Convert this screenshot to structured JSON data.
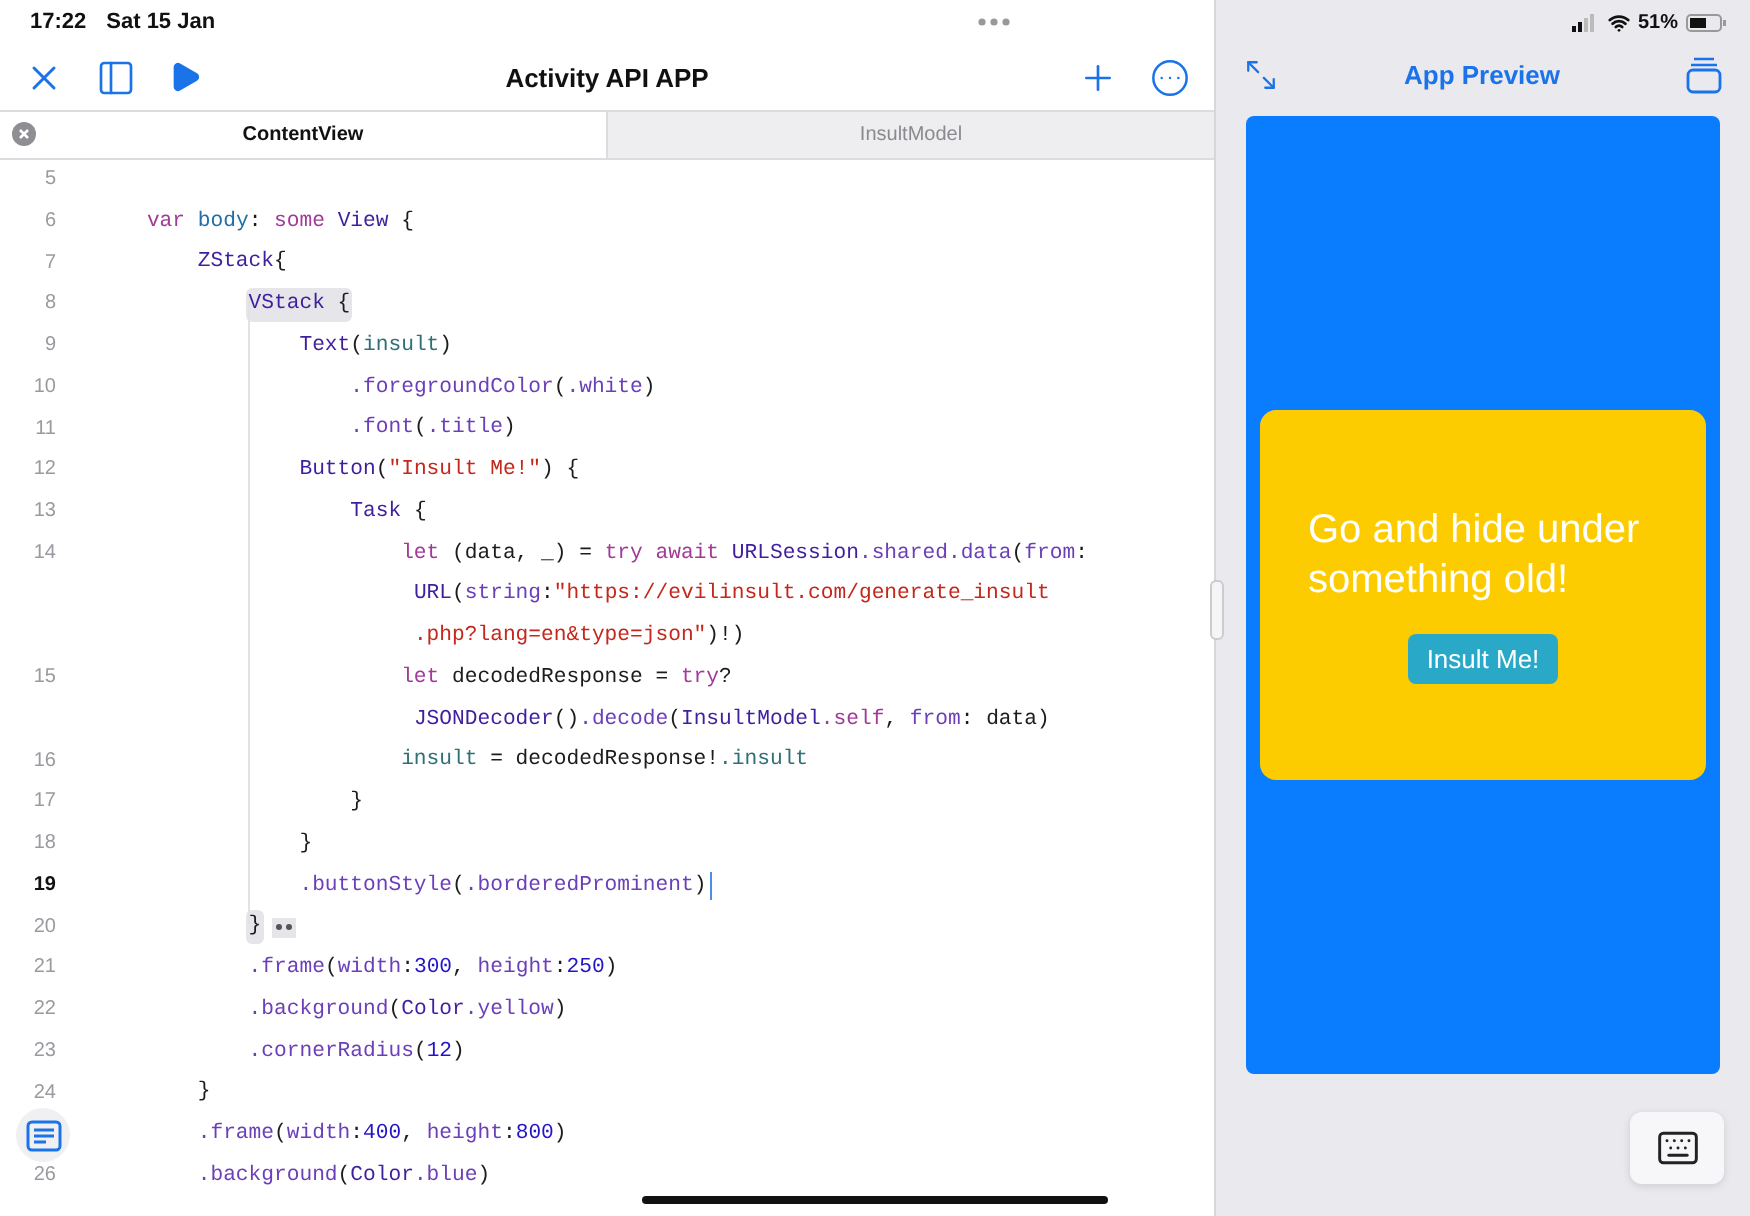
{
  "status_bar": {
    "time": "17:22",
    "date": "Sat 15 Jan",
    "battery": "51%"
  },
  "toolbar": {
    "title": "Activity API APP"
  },
  "tabs": [
    {
      "label": "ContentView",
      "selected": true,
      "closable": true
    },
    {
      "label": "InsultModel",
      "selected": false,
      "closable": false
    }
  ],
  "editor": {
    "lines": [
      {
        "number": "5"
      },
      {
        "number": "6",
        "rows": [
          {
            "tokens": [
              {
                "text": "    var ",
                "kind": "keyword"
              },
              {
                "text": "body",
                "kind": "decl"
              },
              {
                "text": ": ",
                "kind": "plain"
              },
              {
                "text": "some ",
                "kind": "keyword"
              },
              {
                "text": "View",
                "kind": "type"
              },
              {
                "text": " {",
                "kind": "plain"
              }
            ]
          }
        ]
      },
      {
        "number": "7",
        "rows": [
          {
            "tokens": [
              {
                "text": "        ZStack",
                "kind": "type"
              },
              {
                "text": "{",
                "kind": "plain"
              }
            ]
          }
        ]
      },
      {
        "number": "8",
        "highlighted": true,
        "rows": [
          {
            "tokens": [
              {
                "text": "            VStack",
                "kind": "type"
              },
              {
                "text": " {",
                "kind": "plain"
              }
            ]
          }
        ]
      },
      {
        "number": "9",
        "rows": [
          {
            "tokens": [
              {
                "text": "                Text",
                "kind": "type"
              },
              {
                "text": "(",
                "kind": "plain"
              },
              {
                "text": "insult",
                "kind": "var"
              },
              {
                "text": ")",
                "kind": "plain"
              }
            ]
          }
        ]
      },
      {
        "number": "10",
        "rows": [
          {
            "tokens": [
              {
                "text": "                    .foregroundColor",
                "kind": "member"
              },
              {
                "text": "(",
                "kind": "plain"
              },
              {
                "text": ".white",
                "kind": "member"
              },
              {
                "text": ")",
                "kind": "plain"
              }
            ]
          }
        ]
      },
      {
        "number": "11",
        "rows": [
          {
            "tokens": [
              {
                "text": "                    .font",
                "kind": "member"
              },
              {
                "text": "(",
                "kind": "plain"
              },
              {
                "text": ".title",
                "kind": "member"
              },
              {
                "text": ")",
                "kind": "plain"
              }
            ]
          }
        ]
      },
      {
        "number": "12",
        "rows": [
          {
            "tokens": [
              {
                "text": "                Button",
                "kind": "type"
              },
              {
                "text": "(",
                "kind": "plain"
              },
              {
                "text": "\"Insult Me!\"",
                "kind": "string"
              },
              {
                "text": ") {",
                "kind": "plain"
              }
            ]
          }
        ]
      },
      {
        "number": "13",
        "rows": [
          {
            "tokens": [
              {
                "text": "                    Task",
                "kind": "type"
              },
              {
                "text": " {",
                "kind": "plain"
              }
            ]
          }
        ]
      },
      {
        "number": "14",
        "rows": [
          {
            "tokens": [
              {
                "text": "                        let ",
                "kind": "keyword"
              },
              {
                "text": "(data, _) = ",
                "kind": "plain"
              },
              {
                "text": "try await ",
                "kind": "keyword"
              },
              {
                "text": "URLSession",
                "kind": "type"
              },
              {
                "text": ".shared.data",
                "kind": "member"
              },
              {
                "text": "(",
                "kind": "plain"
              },
              {
                "text": "from",
                "kind": "member"
              },
              {
                "text": ":",
                "kind": "plain"
              }
            ]
          },
          {
            "tokens": [
              {
                "text": "                         URL",
                "kind": "type"
              },
              {
                "text": "(",
                "kind": "plain"
              },
              {
                "text": "string",
                "kind": "member"
              },
              {
                "text": ":",
                "kind": "plain"
              },
              {
                "text": "\"https://evilinsult.com/generate_insult",
                "kind": "string"
              }
            ]
          },
          {
            "tokens": [
              {
                "text": "                         .php?lang=en&type=json\"",
                "kind": "string"
              },
              {
                "text": ")!)",
                "kind": "plain"
              }
            ]
          }
        ]
      },
      {
        "number": "15",
        "rows": [
          {
            "tokens": [
              {
                "text": "                        let ",
                "kind": "keyword"
              },
              {
                "text": "decodedResponse = ",
                "kind": "plain"
              },
              {
                "text": "try",
                "kind": "keyword"
              },
              {
                "text": "?",
                "kind": "plain"
              }
            ]
          },
          {
            "tokens": [
              {
                "text": "                         JSONDecoder",
                "kind": "type"
              },
              {
                "text": "()",
                "kind": "plain"
              },
              {
                "text": ".decode",
                "kind": "member"
              },
              {
                "text": "(",
                "kind": "plain"
              },
              {
                "text": "InsultModel",
                "kind": "type"
              },
              {
                "text": ".self",
                "kind": "keyword"
              },
              {
                "text": ", ",
                "kind": "plain"
              },
              {
                "text": "from",
                "kind": "member"
              },
              {
                "text": ": data)",
                "kind": "plain"
              }
            ]
          }
        ]
      },
      {
        "number": "16",
        "rows": [
          {
            "tokens": [
              {
                "text": "                        insult",
                "kind": "var"
              },
              {
                "text": " = decodedResponse!",
                "kind": "plain"
              },
              {
                "text": ".insult",
                "kind": "var"
              }
            ]
          }
        ]
      },
      {
        "number": "17",
        "rows": [
          {
            "tokens": [
              {
                "text": "                    }",
                "kind": "plain"
              }
            ]
          }
        ]
      },
      {
        "number": "18",
        "rows": [
          {
            "tokens": [
              {
                "text": "                }",
                "kind": "plain"
              }
            ]
          }
        ]
      },
      {
        "number": "19",
        "current": true,
        "rows": [
          {
            "tokens": [
              {
                "text": "                .buttonStyle",
                "kind": "member"
              },
              {
                "text": "(",
                "kind": "plain"
              },
              {
                "text": ".borderedProminent",
                "kind": "member"
              },
              {
                "text": ")",
                "kind": "plain"
              }
            ]
          }
        ]
      },
      {
        "number": "20",
        "highlighted": true,
        "folded": true,
        "rows": [
          {
            "tokens": [
              {
                "text": "            }",
                "kind": "plain"
              }
            ]
          }
        ]
      },
      {
        "number": "21",
        "rows": [
          {
            "tokens": [
              {
                "text": "            .frame",
                "kind": "member"
              },
              {
                "text": "(",
                "kind": "plain"
              },
              {
                "text": "width",
                "kind": "member"
              },
              {
                "text": ":",
                "kind": "plain"
              },
              {
                "text": "300",
                "kind": "number"
              },
              {
                "text": ", ",
                "kind": "plain"
              },
              {
                "text": "height",
                "kind": "member"
              },
              {
                "text": ":",
                "kind": "plain"
              },
              {
                "text": "250",
                "kind": "number"
              },
              {
                "text": ")",
                "kind": "plain"
              }
            ]
          }
        ]
      },
      {
        "number": "22",
        "rows": [
          {
            "tokens": [
              {
                "text": "            .background",
                "kind": "member"
              },
              {
                "text": "(",
                "kind": "plain"
              },
              {
                "text": "Color",
                "kind": "type"
              },
              {
                "text": ".yellow",
                "kind": "member"
              },
              {
                "text": ")",
                "kind": "plain"
              }
            ]
          }
        ]
      },
      {
        "number": "23",
        "rows": [
          {
            "tokens": [
              {
                "text": "            .cornerRadius",
                "kind": "member"
              },
              {
                "text": "(",
                "kind": "plain"
              },
              {
                "text": "12",
                "kind": "number"
              },
              {
                "text": ")",
                "kind": "plain"
              }
            ]
          }
        ]
      },
      {
        "number": "24",
        "rows": [
          {
            "tokens": [
              {
                "text": "        }",
                "kind": "plain"
              }
            ]
          }
        ]
      },
      {
        "rows": [
          {
            "tokens": [
              {
                "text": "        .frame",
                "kind": "member"
              },
              {
                "text": "(",
                "kind": "plain"
              },
              {
                "text": "width",
                "kind": "member"
              },
              {
                "text": ":",
                "kind": "plain"
              },
              {
                "text": "400",
                "kind": "number"
              },
              {
                "text": ", ",
                "kind": "plain"
              },
              {
                "text": "height",
                "kind": "member"
              },
              {
                "text": ":",
                "kind": "plain"
              },
              {
                "text": "800",
                "kind": "number"
              },
              {
                "text": ")",
                "kind": "plain"
              }
            ]
          }
        ]
      },
      {
        "number": "26",
        "rows": [
          {
            "tokens": [
              {
                "text": "        .background",
                "kind": "member"
              },
              {
                "text": "(",
                "kind": "plain"
              },
              {
                "text": "Color",
                "kind": "type"
              },
              {
                "text": ".blue",
                "kind": "member"
              },
              {
                "text": ")",
                "kind": "plain"
              }
            ]
          }
        ]
      }
    ]
  },
  "preview": {
    "title": "App Preview",
    "insult": "Go and hide under something old!",
    "button": "Insult Me!"
  }
}
